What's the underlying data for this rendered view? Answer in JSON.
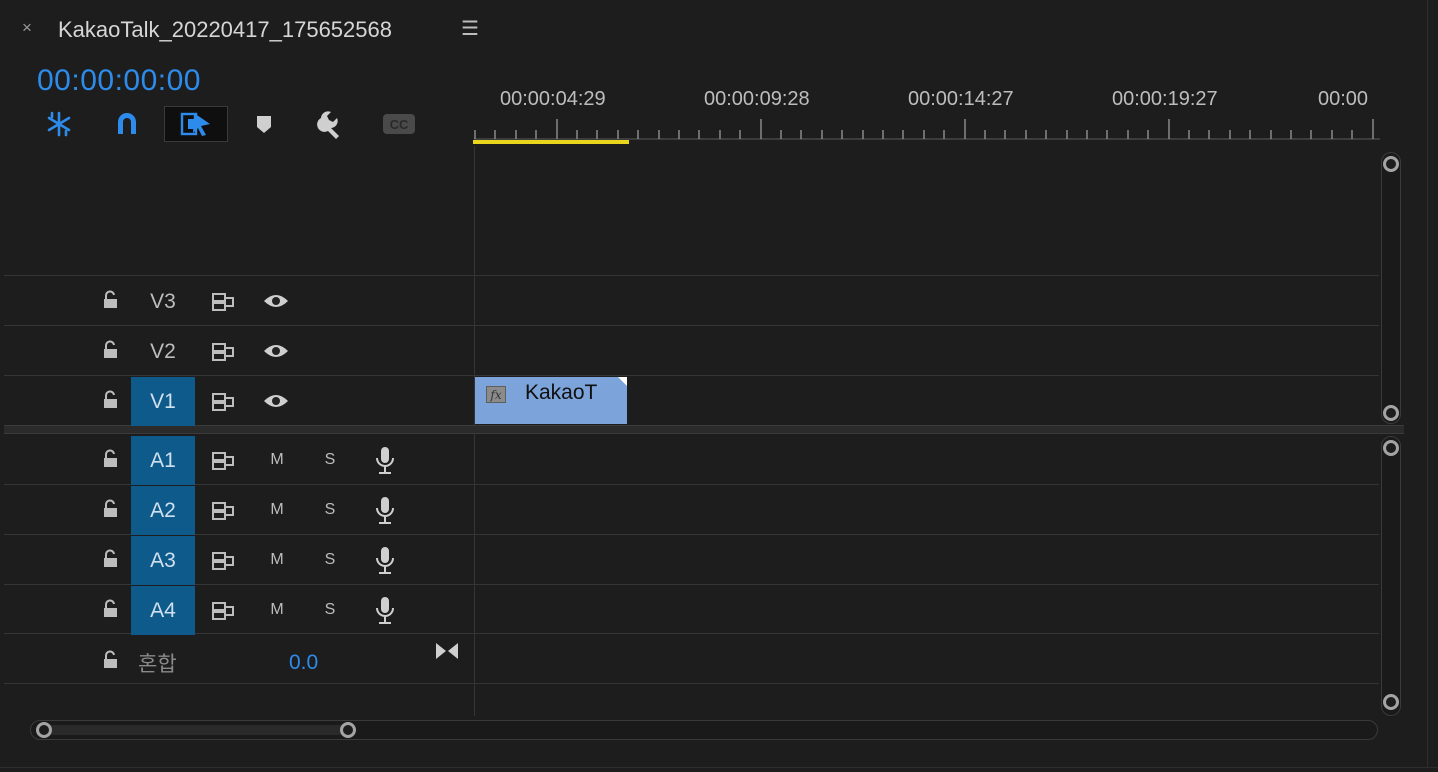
{
  "header": {
    "close_glyph": "×",
    "sequence_title": "KakaoTalk_20220417_175652568",
    "menu_glyph": "☰"
  },
  "timecode": "00:00:00:00",
  "toolbar": {
    "tools": [
      "nest-icon",
      "snap-magnet-icon",
      "linked-selection-icon",
      "add-marker-icon",
      "settings-wrench-icon",
      "captions-icon"
    ],
    "captions_label": "CC",
    "accent_color": "#2d8ceb"
  },
  "ruler": {
    "labels": [
      "00:00:04:29",
      "00:00:09:28",
      "00:00:14:27",
      "00:00:19:27",
      "00:00"
    ],
    "work_area_color": "#e8d51c"
  },
  "video_tracks": [
    {
      "name": "V3",
      "targeted": false
    },
    {
      "name": "V2",
      "targeted": false
    },
    {
      "name": "V1",
      "targeted": true
    }
  ],
  "audio_tracks": [
    {
      "name": "A1",
      "mute": "M",
      "solo": "S"
    },
    {
      "name": "A2",
      "mute": "M",
      "solo": "S"
    },
    {
      "name": "A3",
      "mute": "M",
      "solo": "S"
    },
    {
      "name": "A4",
      "mute": "M",
      "solo": "S"
    }
  ],
  "clip": {
    "fx_label": "fx",
    "name": "KakaoT",
    "color": "#7ca4da"
  },
  "mix": {
    "label": "혼합",
    "value": "0.0"
  }
}
